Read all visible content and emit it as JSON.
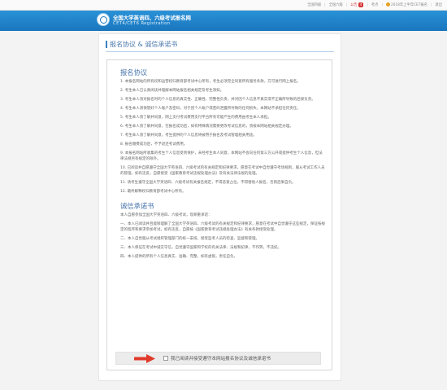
{
  "topbar": {
    "links": [
      {
        "label": "全国四级"
      },
      {
        "label": "全国六级"
      },
      {
        "label": "公告",
        "badge": "4"
      },
      {
        "label": "考点"
      },
      {
        "label": "2018年上半年CET报名"
      },
      {
        "label": "退出"
      }
    ],
    "colors": {
      "notice": "#d63333"
    }
  },
  "header": {
    "logo_cn": "全国大学英语四、六级考试报名网",
    "logo_en": "CET4/CET6 Registration"
  },
  "card": {
    "title": "报名协议 & 诚信承诺书",
    "agreement_title": "报名协议",
    "agreement_paragraphs": [
      "1. 本报名网站的所有权和运营权归教育部考试中心所有，考生必须完全同意所有服务条款，方可进行网上报名。",
      "2. 考生本人已认真阅读并理解本网站报名相关规定及考生须知。",
      "3. 考生本人须对报名时的个人信息的真实性、正确性、完整性负责，并对因个人信息不真实或不正确所导致的后果负责。",
      "4. 考生本人须保管好个人账户及密码，对于因个人账户或密码泄露所导致的任何损失，本网站不承担任何责任。",
      "5. 考生本人须了解并同意，网上支付考试费用支付平台所有可能产生的费用由考生本人承担。",
      "6. 考生本人须了解并同意，在报名成功后，如有特殊情况需要更改考试信息的，须按本网站相关规定办理。",
      "7. 考生本人须了解并同意，考生提供的个人信息将被用于报名及考试管理相关用途。",
      "8. 报名缴费成功后，不予退还考试费用。",
      "9. 本报名网站所收集的考生个人信息受到保护，未经考生本人同意，本网站不会向任何第三方公开或提供考生个人信息，但法律法规另有规定的除外。",
      "10. 已阅读并自愿遵守全国大学英语四、六级考试的有关规定和纪律要求，愿意在考试中自觉遵守考场规则，服从考试工作人员的管理，如有违反，自愿接受《国家教育考试违规处理办法》及有关法律法规的处理。",
      "11. 请考生遵守全国大学英语四、六级考试有关报名规定，不得恶意占位，不得替他人报名，否则后果自负。",
      "12. 最终解释权归教育部考试中心所有。"
    ],
    "commitment_title": "诚信承诺书",
    "commitment_paragraphs": [
      "本人自愿参加全国大学英语四、六级考试，现郑重承诺：",
      "一、本人已阅读并且能够理解了全国大学英语四、六级考试的有关规定和纪律要求，愿意在考试中自觉遵守这些规定，保证按规定的程序和要求参加考试，如有违反，自愿按《国家教育考试违规处理办法》有关条款接受处理。",
      "二、本人自觉服从考试组织管理部门的统一安排，接受监考人员的检查、监督和管理。",
      "三、本人保证在考试中诚实守信，自觉遵守国家和学校的有关法律、法规和纪律，不作弊，不违纪。",
      "四、本人提供的所有个人信息真实、准确、完整，如有虚假，责任自负。"
    ]
  },
  "confirm": {
    "label": "我已阅读并接受遵守本网站报名协议及诚信承诺书",
    "checked": false,
    "arrow_color": "#e03a2b"
  }
}
